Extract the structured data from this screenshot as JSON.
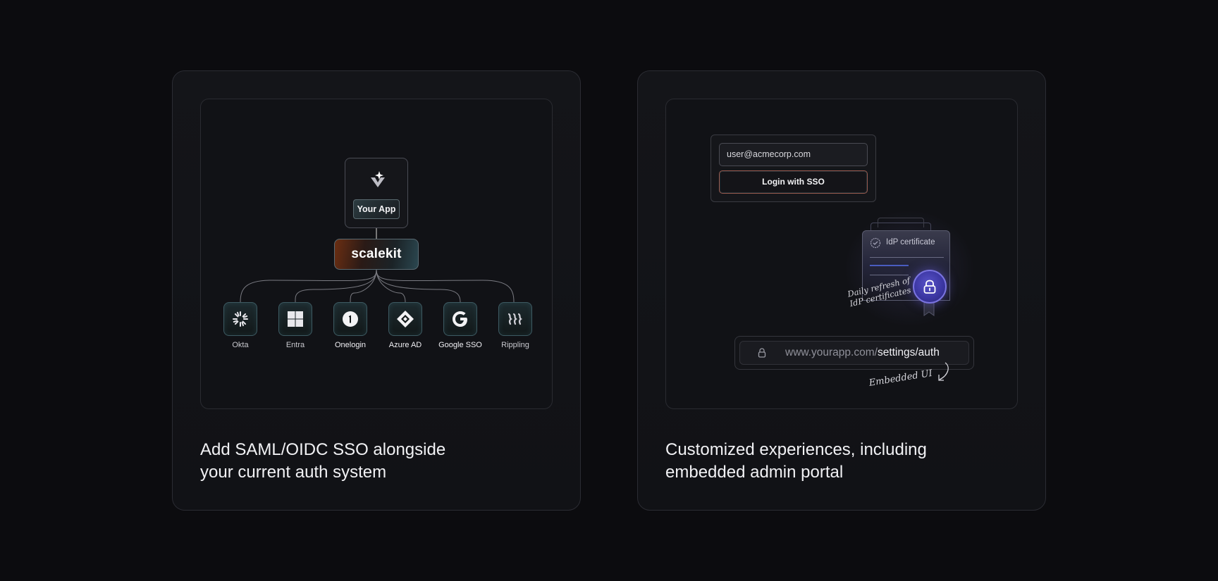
{
  "left_card": {
    "app_label": "Your App",
    "brand": "scalekit",
    "providers": [
      {
        "name": "Okta",
        "icon": "okta-icon"
      },
      {
        "name": "Entra",
        "icon": "entra-icon"
      },
      {
        "name": "Onelogin",
        "icon": "onelogin-icon"
      },
      {
        "name": "Azure AD",
        "icon": "azure-ad-icon"
      },
      {
        "name": "Google SSO",
        "icon": "google-icon"
      },
      {
        "name": "Rippling",
        "icon": "rippling-icon"
      }
    ],
    "caption": "Add SAML/OIDC SSO alongside\n your current auth system"
  },
  "right_card": {
    "email_value": "user@acmecorp.com",
    "login_button": "Login with SSO",
    "cert_title": "IdP certificate",
    "cert_note": "Daily refresh of\nIdP certificates",
    "url_prefix": "www.yourapp.com/",
    "url_path": "settings/auth",
    "embedded_note": "Embedded UI",
    "caption": "Customized experiences, including\nembedded admin portal"
  },
  "colors": {
    "background": "#0c0c0f",
    "card": "#141519",
    "accent_purple": "#5852c8",
    "accent_orange": "#6b2e12"
  }
}
